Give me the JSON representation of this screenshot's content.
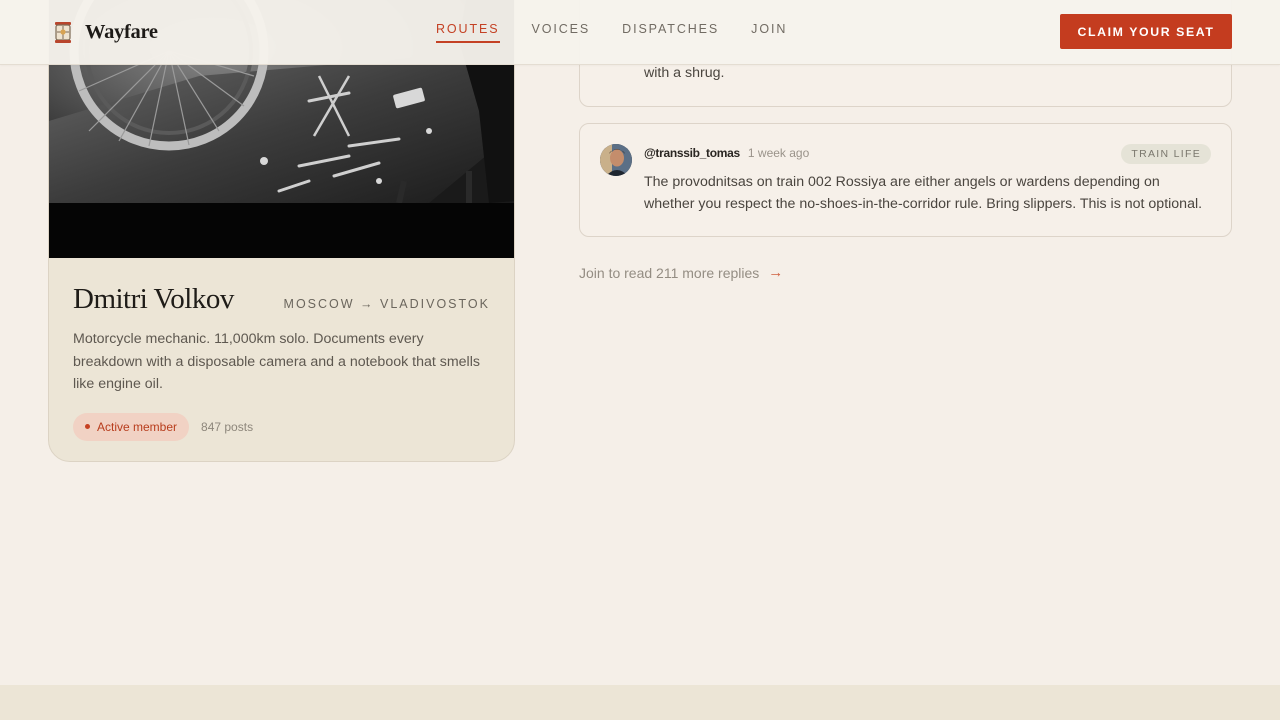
{
  "header": {
    "brand_name": "Wayfare",
    "nav": [
      {
        "label": "ROUTES",
        "active": true
      },
      {
        "label": "VOICES",
        "active": false
      },
      {
        "label": "DISPATCHES",
        "active": false
      },
      {
        "label": "JOIN",
        "active": false
      }
    ],
    "cta_label": "CLAIM YOUR SEAT"
  },
  "profile": {
    "name": "Dmitri Volkov",
    "route": "MOSCOW → VLADIVOSTOK",
    "bio": "Motorcycle mechanic. 11,000km solo. Documents every breakdown with a disposable camera and a notebook that smells like engine oil.",
    "badge": "Active member",
    "posts": "847 posts"
  },
  "replies": {
    "previous_text": "with a shrug.",
    "main": {
      "handle": "@transsib_tomas",
      "time": "1 week ago",
      "tag": "TRAIN LIFE",
      "text": "The provodnitsas on train 002 Rossiya are either angels or wardens depending on whether you respect the no-shoes-in-the-corridor rule. Bring slippers. This is not optional."
    },
    "more_label": "Join to read 211 more replies",
    "more_arrow": "→"
  },
  "colors": {
    "accent": "#c43c1f",
    "background": "#f5efe8",
    "card": "#ece5d6"
  },
  "icons": {
    "brand": "lantern-logo-icon",
    "more": "arrow-right-icon"
  }
}
